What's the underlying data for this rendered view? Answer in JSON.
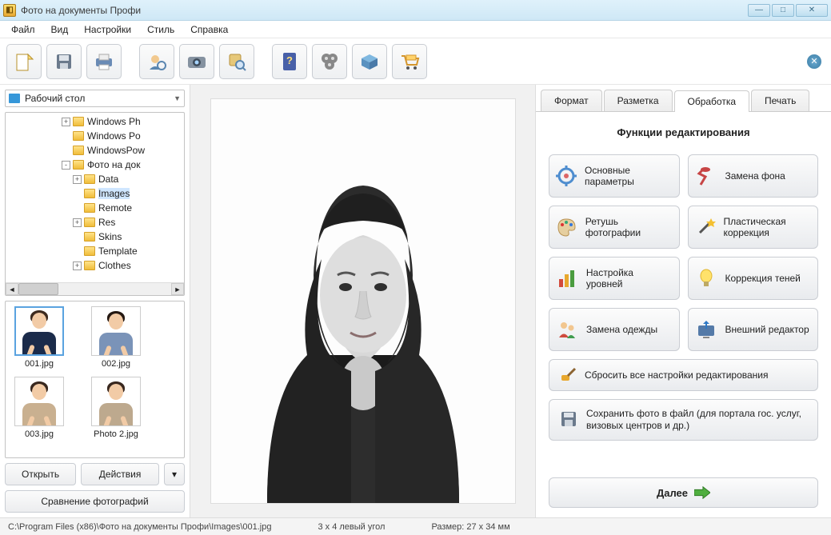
{
  "window": {
    "title": "Фото на документы Профи"
  },
  "menu": {
    "file": "Файл",
    "view": "Вид",
    "settings": "Настройки",
    "style": "Стиль",
    "help": "Справка"
  },
  "toolbar": {
    "items": [
      "new",
      "save",
      "print",
      "user",
      "camera",
      "search",
      "book",
      "reel",
      "package",
      "cart"
    ]
  },
  "left": {
    "path_label": "Рабочий стол",
    "tree": {
      "items": [
        {
          "indent": 5,
          "exp": "+",
          "label": "Windows Ph"
        },
        {
          "indent": 5,
          "exp": "",
          "label": "Windows Po"
        },
        {
          "indent": 5,
          "exp": "",
          "label": "WindowsPow"
        },
        {
          "indent": 5,
          "exp": "-",
          "label": "Фото на док"
        },
        {
          "indent": 6,
          "exp": "+",
          "label": "Data"
        },
        {
          "indent": 6,
          "exp": "",
          "label": "Images",
          "selected": true
        },
        {
          "indent": 6,
          "exp": "",
          "label": "Remote"
        },
        {
          "indent": 6,
          "exp": "+",
          "label": "Res"
        },
        {
          "indent": 6,
          "exp": "",
          "label": "Skins"
        },
        {
          "indent": 6,
          "exp": "",
          "label": "Template"
        },
        {
          "indent": 6,
          "exp": "+",
          "label": "Clothes"
        }
      ]
    },
    "thumbs": [
      {
        "label": "001.jpg",
        "cls": "p1",
        "selected": true
      },
      {
        "label": "002.jpg",
        "cls": "p2"
      },
      {
        "label": "003.jpg",
        "cls": "p3"
      },
      {
        "label": "Photo 2.jpg",
        "cls": "p4"
      }
    ],
    "open_btn": "Открыть",
    "actions_btn": "Действия",
    "compare_btn": "Сравнение фотографий"
  },
  "tabs": {
    "format": "Формат",
    "layout": "Разметка",
    "processing": "Обработка",
    "print": "Печать"
  },
  "processing": {
    "header": "Функции редактирования",
    "basic": "Основные параметры",
    "bg_replace": "Замена фона",
    "retouch": "Ретушь фотографии",
    "plastic": "Пластическая коррекция",
    "levels": "Настройка уровней",
    "shadows": "Коррекция теней",
    "clothes": "Замена одежды",
    "external": "Внешний редактор",
    "reset": "Сбросить все настройки редактирования",
    "save_file": "Сохранить фото в файл (для портала гос. услуг, визовых центров и др.)",
    "next": "Далее"
  },
  "status": {
    "path": "C:\\Program Files (x86)\\Фото на документы Профи\\Images\\001.jpg",
    "crop": "3 x 4 левый угол",
    "size": "Размер: 27 x 34 мм"
  }
}
